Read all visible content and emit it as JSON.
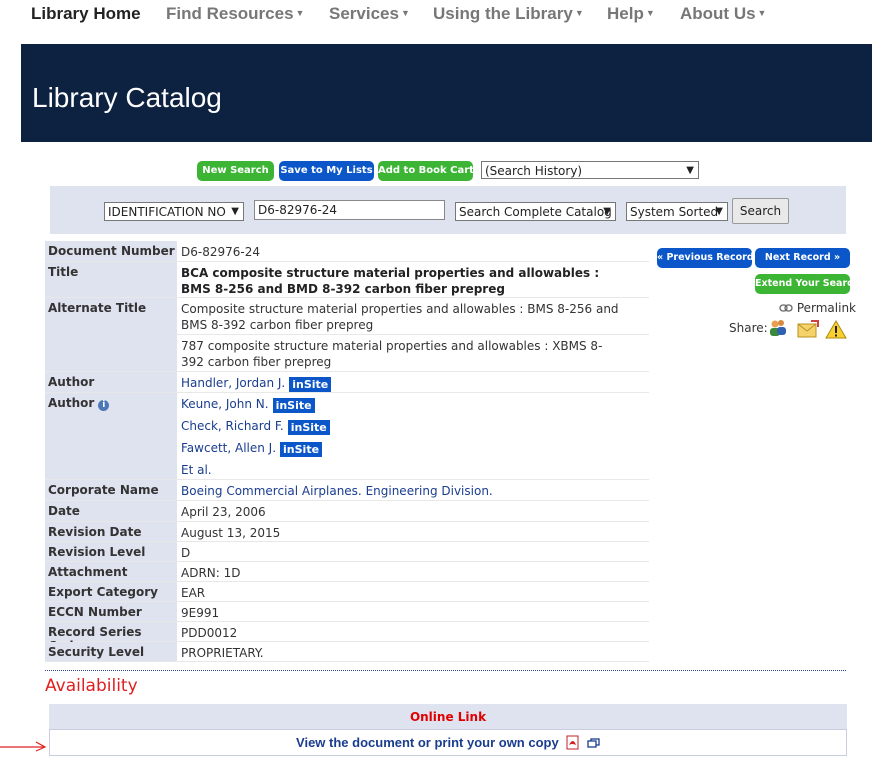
{
  "nav": {
    "home": "Library Home",
    "find": "Find Resources",
    "services": "Services",
    "using": "Using the Library",
    "help": "Help",
    "about": "About Us"
  },
  "banner": {
    "title": "Library Catalog"
  },
  "actions": {
    "new_search": "New Search",
    "save": "Save to My Lists",
    "book_cart": "Add to Book Cart",
    "history": "(Search History)"
  },
  "search": {
    "field": "IDENTIFICATION NO",
    "query": "D6-82976-24",
    "scope": "Search Complete Catalog",
    "sort": "System Sorted",
    "button": "Search"
  },
  "record": {
    "document_number": {
      "label": "Document Number",
      "value": "D6-82976-24"
    },
    "title": {
      "label": "Title",
      "value": "BCA composite structure material properties and allowables : BMS 8-256 and BMD 8-392 carbon fiber prepreg"
    },
    "alt_title": {
      "label": "Alternate Title",
      "value1": "Composite structure material properties and allowables : BMS 8-256 and BMS 8-392 carbon fiber prepreg",
      "value2": "787 composite structure material properties and allowables : XBMS 8-392 carbon fiber prepreg"
    },
    "author1": {
      "label": "Author",
      "value": "Handler, Jordan J."
    },
    "author2": {
      "label": "Author",
      "values": [
        "Keune, John N.",
        "Check, Richard F.",
        "Fawcett, Allen J.",
        "Et al."
      ]
    },
    "insite": "inSite",
    "corporate": {
      "label": "Corporate Name",
      "value": "Boeing Commercial Airplanes. Engineering Division."
    },
    "date": {
      "label": "Date",
      "value": "April 23, 2006"
    },
    "revision_date": {
      "label": "Revision Date",
      "value": "August 13, 2015"
    },
    "revision_level": {
      "label": "Revision Level",
      "value": "D"
    },
    "attachment": {
      "label": "Attachment",
      "value": "ADRN: 1D"
    },
    "export": {
      "label": "Export Category",
      "value": "EAR"
    },
    "eccn": {
      "label": "ECCN Number",
      "value": "9E991"
    },
    "series": {
      "label": "Record Series Code",
      "value": "PDD0012"
    },
    "security": {
      "label": "Security Level",
      "value": "PROPRIETARY."
    }
  },
  "side": {
    "prev": "« Previous Record",
    "next": "Next Record »",
    "extend": "Extend Your Search",
    "permalink": "Permalink",
    "share": "Share:"
  },
  "availability": {
    "heading": "Availability",
    "online_link": "Online Link",
    "view": "View the document or print your own copy"
  },
  "colors": {
    "banner": "#0d2240",
    "green_button": "#3cb534",
    "blue_button": "#0b57c9",
    "label_bg": "#dfe3f0",
    "alert_red": "#e02020"
  }
}
